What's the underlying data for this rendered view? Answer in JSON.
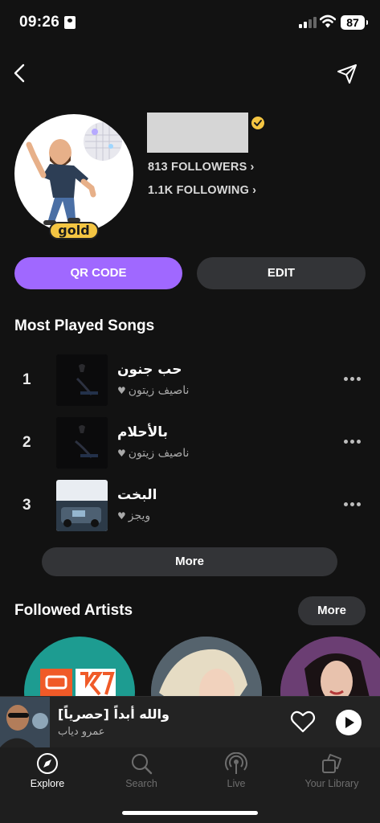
{
  "status_bar": {
    "time": "09:26",
    "battery": "87"
  },
  "profile": {
    "followers": "813 FOLLOWERS",
    "following": "1.1K FOLLOWING",
    "badge": "gold"
  },
  "actions": {
    "qr_code": "QR CODE",
    "edit": "EDIT"
  },
  "most_played": {
    "title": "Most Played Songs",
    "songs": [
      {
        "rank": "1",
        "title": "حب جنون",
        "artist": "ناصيف زيتون"
      },
      {
        "rank": "2",
        "title": "بالأحلام",
        "artist": "ناصيف زيتون"
      },
      {
        "rank": "3",
        "title": "البخت",
        "artist": "ويجز"
      }
    ],
    "more_label": "More"
  },
  "followed_artists": {
    "title": "Followed Artists",
    "more_label": "More"
  },
  "now_playing": {
    "title": "والله أبداً [حصرياً]",
    "artist": "عمرو دياب"
  },
  "tabs": [
    {
      "label": "Explore",
      "icon": "compass-icon",
      "active": true
    },
    {
      "label": "Search",
      "icon": "search-icon",
      "active": false
    },
    {
      "label": "Live",
      "icon": "broadcast-icon",
      "active": false
    },
    {
      "label": "Your Library",
      "icon": "library-icon",
      "active": false
    }
  ],
  "colors": {
    "accent": "#a068ff",
    "background": "#121212",
    "surface": "#333437",
    "gold": "#f4c542"
  }
}
